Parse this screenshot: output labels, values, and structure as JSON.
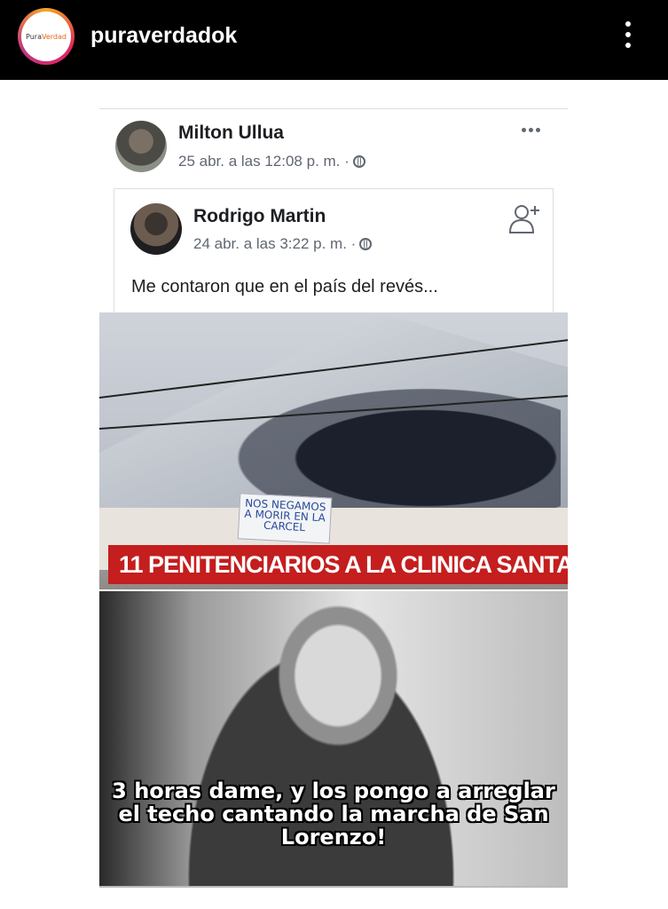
{
  "header": {
    "avatar_text_a": "Pura",
    "avatar_text_b": "Verdad",
    "username": "puraverdadok"
  },
  "post": {
    "author": "Milton Ullua",
    "timestamp": "25 abr. a las 12:08 p. m. ·",
    "shared": {
      "author": "Rodrigo Martin",
      "timestamp": "24 abr. a las 3:22 p. m. ·",
      "text": "Me contaron que en el país del revés..."
    }
  },
  "meme": {
    "banner_text": "NOS NEGAMOS A MORIR EN LA CARCEL",
    "news_caption": "11 PENITENCIARIOS A LA CLINICA SANTA",
    "bottom_text": "3 horas dame, y los pongo a arreglar el techo cantando la marcha de San Lorenzo!"
  },
  "colors": {
    "topbar": "#000000",
    "caption_red": "#c41e1e",
    "fb_text": "#1c1e21",
    "fb_meta": "#606770"
  }
}
